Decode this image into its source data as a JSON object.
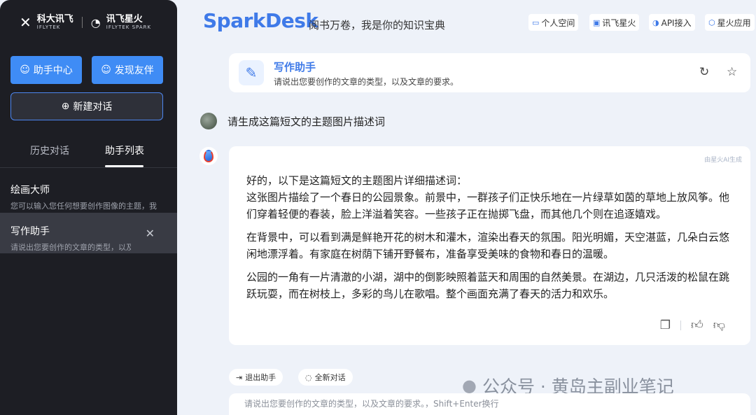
{
  "sidebar": {
    "logo": {
      "brand": "科大讯飞",
      "brand_sub": "IFLYTEK",
      "product": "讯飞星火",
      "product_sub": "IFLYTEK SPARK"
    },
    "helper_center_label": "助手中心",
    "discover_label": "发现友伴",
    "new_chat_label": "新建对话",
    "tabs": {
      "history": "历史对话",
      "assistant_list": "助手列表"
    },
    "assistants": [
      {
        "name": "绘画大师",
        "desc": "您可以输入您任何想要创作图像的主题，我"
      },
      {
        "name": "写作助手",
        "desc": "请说出您要创作的文章的类型，以及文章的要求。"
      }
    ]
  },
  "header": {
    "brand": "SparkDesk",
    "tagline": "阅书万卷，我是你的知识宝典",
    "nav": [
      "个人空间",
      "讯飞星火",
      "API接入",
      "星火应用"
    ]
  },
  "assistant_card": {
    "title": "写作助手",
    "desc": "请说出您要创作的文章的类型，以及文章的要求。"
  },
  "chat": {
    "user_message": "请生成这篇短文的主题图片描述词",
    "ai_tag": "由星火AI生成",
    "answer": [
      "好的，以下是这篇短文的主题图片详细描述词：",
      "这张图片描绘了一个春日的公园景象。前景中，一群孩子们正快乐地在一片绿草如茵的草地上放风筝。他们穿着轻便的春装，脸上洋溢着笑容。一些孩子正在抛掷飞盘，而其他几个则在追逐嬉戏。",
      "在背景中，可以看到满是鲜艳开花的树木和灌木，渲染出春天的氛围。阳光明媚，天空湛蓝，几朵白云悠闲地漂浮着。有家庭在树荫下铺开野餐布，准备享受美味的食物和春日的温暖。",
      "公园的一角有一片清澈的小湖，湖中的倒影映照着蓝天和周围的自然美景。在湖边，几只活泼的松鼠在跳跃玩耍，而在树枝上，多彩的鸟儿在歌唱。整个画面充满了春天的活力和欢乐。"
    ]
  },
  "footer": {
    "exit_label": "退出助手",
    "new_chat_label": "全新对话",
    "watermark": "公众号 · 黄岛主副业笔记",
    "input_placeholder": "请说出您要创作的文章的类型，以及文章的要求。，Shift+Enter换行"
  },
  "colors": {
    "accent": "#3f7ae8",
    "sidebar_bg": "#1d1e24",
    "button_blue": "#3f8cf5",
    "page_bg": "#eef2f9"
  },
  "icons": [
    "folder-icon",
    "monitor-icon",
    "api-icon",
    "cube-icon",
    "pen-icon",
    "edit-icon",
    "star-icon",
    "copy-icon",
    "thumbs-up-icon",
    "thumbs-down-icon",
    "exit-icon",
    "chat-icon",
    "close-icon",
    "plus-circle-icon",
    "wechat-icon"
  ]
}
